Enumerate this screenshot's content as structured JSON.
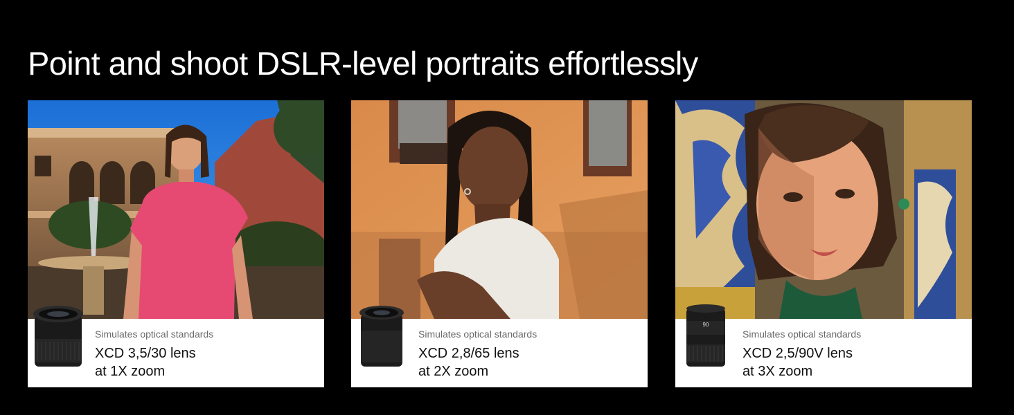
{
  "headline": "Point and shoot DSLR-level portraits effortlessly",
  "cards": [
    {
      "caption": "Simulates optical standards",
      "lens": "XCD 3,5/30 lens",
      "zoom": "at 1X zoom"
    },
    {
      "caption": "Simulates optical standards",
      "lens": "XCD 2,8/65 lens",
      "zoom": "at 2X zoom"
    },
    {
      "caption": "Simulates optical standards",
      "lens": "XCD 2,5/90V lens",
      "zoom": "at 3X zoom",
      "lens_marking": "90"
    }
  ],
  "colors": {
    "background": "#000000",
    "card_info_bg": "#ffffff",
    "caption_gray": "#6a6a6a",
    "text_dark": "#111111"
  }
}
